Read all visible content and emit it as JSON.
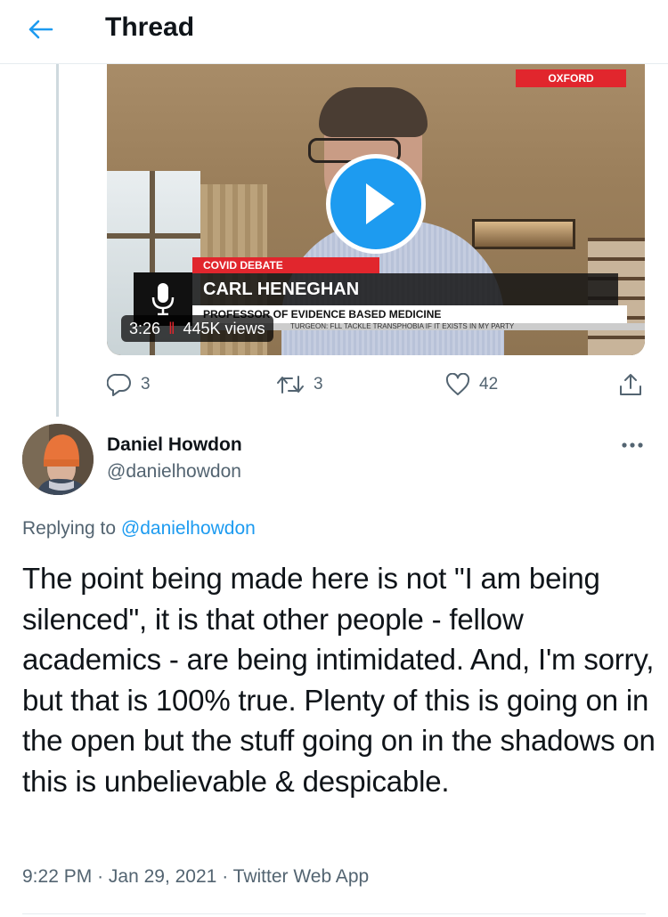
{
  "header": {
    "title": "Thread"
  },
  "media": {
    "badge_location": "OXFORD",
    "lower_third_topic": "COVID DEBATE",
    "lower_third_name": "CARL HENEGHAN",
    "lower_third_title": "PROFESSOR OF EVIDENCE BASED MEDICINE",
    "ticker_text": "TURGEON: FLL TACKLE TRANSPHOBIA IF IT EXISTS IN MY PARTY",
    "duration": "3:26",
    "views": "445K views"
  },
  "actions": {
    "replies": "3",
    "retweets": "3",
    "likes": "42"
  },
  "tweet": {
    "author_name": "Daniel Howdon",
    "author_handle": "@danielhowdon",
    "replying_prefix": "Replying to",
    "replying_mention": "@danielhowdon",
    "text": "The point being made here is not \"I am being silenced\", it is that other people - fellow academics - are being intimidated. And, I'm sorry, but that is 100% true. Plenty of this is going on in the open but the stuff going on in the shadows on this is unbelievable & despicable.",
    "time": "9:22 PM",
    "date": "Jan 29, 2021",
    "source": "Twitter Web App",
    "separator": "·"
  },
  "colors": {
    "accent": "#1d9bf0",
    "secondary_text": "#536471",
    "primary_text": "#0f1419",
    "news_red": "#e1262d"
  },
  "icons": {
    "back": "arrow-left-icon",
    "reply": "reply-icon",
    "retweet": "retweet-icon",
    "like": "heart-icon",
    "share": "share-icon",
    "more": "more-icon",
    "play": "play-icon",
    "mic": "microphone-icon"
  }
}
